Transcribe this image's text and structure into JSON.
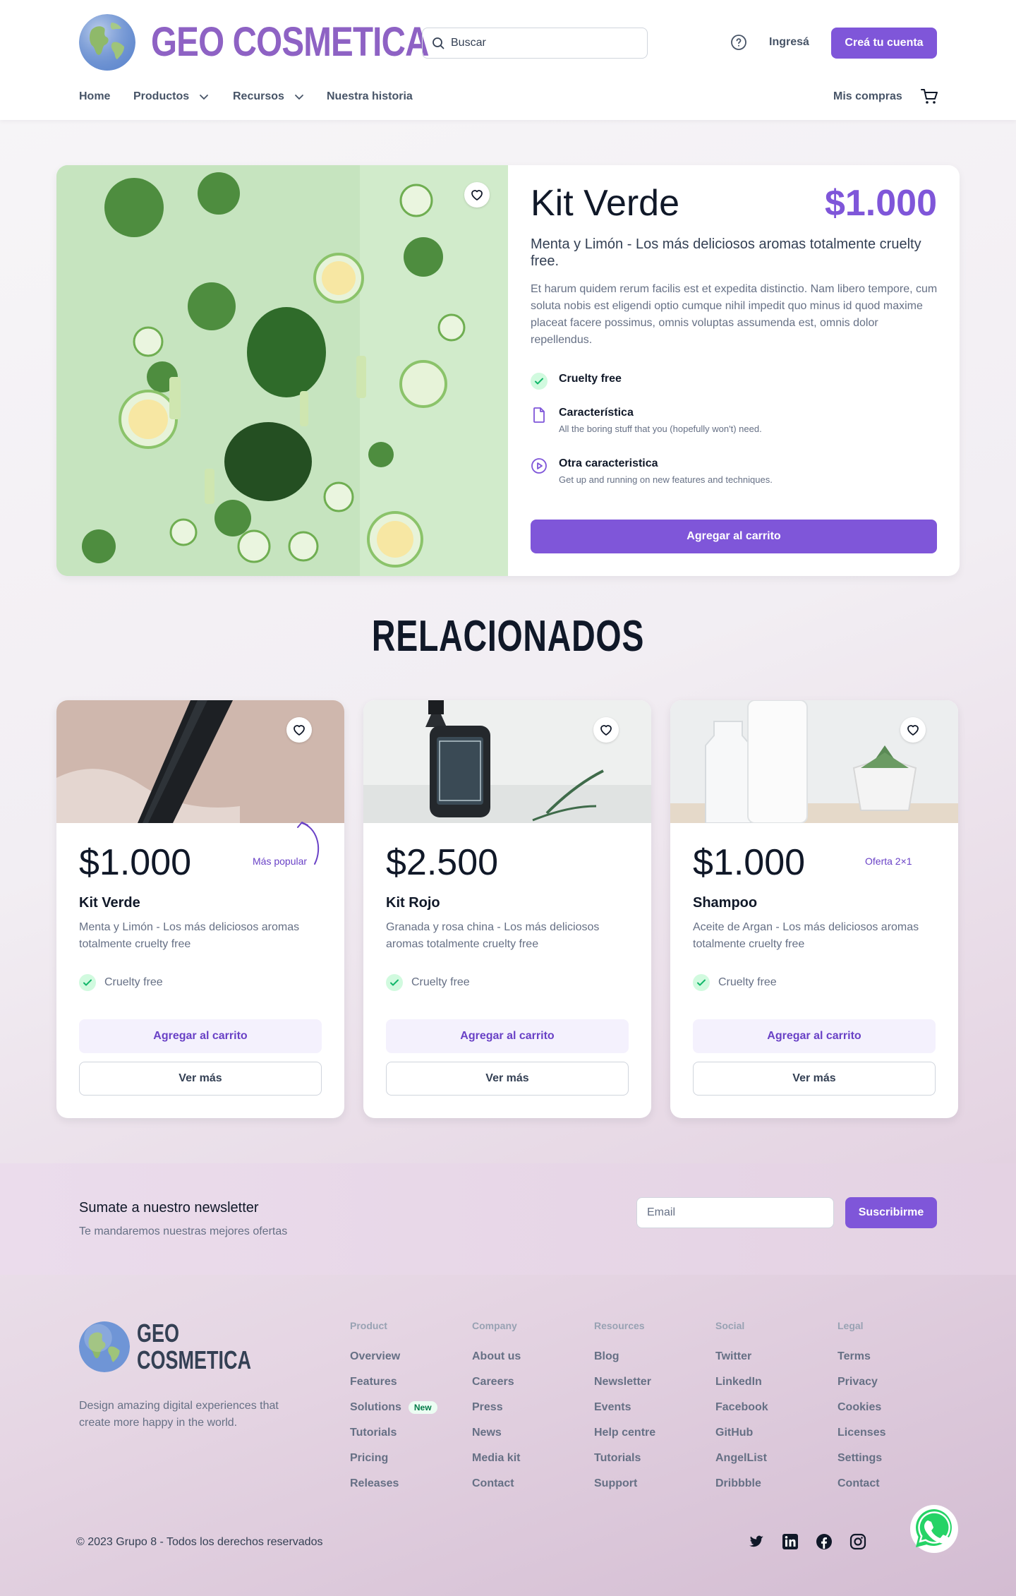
{
  "header": {
    "brand": "GEO COSMETICA",
    "search_placeholder": "Buscar",
    "login": "Ingresá",
    "signup": "Creá tu cuenta",
    "nav": [
      "Home",
      "Productos",
      "Recursos",
      "Nuestra historia"
    ],
    "my_purchases": "Mis compras"
  },
  "product": {
    "title": "Kit Verde",
    "price": "$1.000",
    "subtitle": "Menta y Limón - Los más deliciosos aromas totalmente cruelty free.",
    "description": "Et harum quidem rerum facilis est et expedita distinctio. Nam libero tempore, cum soluta nobis est eligendi optio cumque nihil impedit quo minus id quod maxime placeat facere possimus, omnis voluptas assumenda est, omnis dolor repellendus.",
    "features": [
      {
        "title": "Cruelty free",
        "desc": "",
        "icon": "check-circle-icon"
      },
      {
        "title": "Característica",
        "desc": "All the boring stuff that you (hopefully won't) need.",
        "icon": "file-icon"
      },
      {
        "title": "Otra caracteristica",
        "desc": "Get up and running on new features and techniques.",
        "icon": "play-circle-icon"
      }
    ],
    "add_to_cart": "Agregar al carrito"
  },
  "related": {
    "title": "RELACIONADOS",
    "cards": [
      {
        "price": "$1.000",
        "tag": "Más popular",
        "name": "Kit Verde",
        "desc": "Menta y Limón - Los más deliciosos aromas totalmente cruelty free",
        "feature": "Cruelty free",
        "add": "Agregar al carrito",
        "more": "Ver más"
      },
      {
        "price": "$2.500",
        "tag": "",
        "name": "Kit Rojo",
        "desc": "Granada y rosa china - Los más deliciosos aromas totalmente cruelty free",
        "feature": "Cruelty free",
        "add": "Agregar al carrito",
        "more": "Ver más"
      },
      {
        "price": "$1.000",
        "tag": "Oferta 2×1",
        "name": "Shampoo",
        "desc": "Aceite de Argan - Los más deliciosos aromas totalmente cruelty free",
        "feature": "Cruelty free",
        "add": "Agregar al carrito",
        "more": "Ver más"
      }
    ]
  },
  "newsletter": {
    "title": "Sumate a nuestro newsletter",
    "subtitle": "Te mandaremos nuestras mejores ofertas",
    "email_placeholder": "Email",
    "button": "Suscribirme"
  },
  "footer": {
    "brand_line1": "GEO",
    "brand_line2": "COSMETICA",
    "tagline": "Design amazing digital experiences that create more happy in the world.",
    "columns": [
      {
        "heading": "Product",
        "links": [
          "Overview",
          "Features",
          "Solutions",
          "Tutorials",
          "Pricing",
          "Releases"
        ]
      },
      {
        "heading": "Company",
        "links": [
          "About us",
          "Careers",
          "Press",
          "News",
          "Media kit",
          "Contact"
        ]
      },
      {
        "heading": "Resources",
        "links": [
          "Blog",
          "Newsletter",
          "Events",
          "Help centre",
          "Tutorials",
          "Support"
        ]
      },
      {
        "heading": "Social",
        "links": [
          "Twitter",
          "LinkedIn",
          "Facebook",
          "GitHub",
          "AngelList",
          "Dribbble"
        ]
      },
      {
        "heading": "Legal",
        "links": [
          "Terms",
          "Privacy",
          "Cookies",
          "Licenses",
          "Settings",
          "Contact"
        ]
      }
    ],
    "new_badge": "New",
    "copyright": "© 2023 Grupo 8 - Todos los derechos reservados"
  },
  "colors": {
    "accent": "#7f56d9",
    "brand": "#8e62c4",
    "whatsapp": "#25d366"
  }
}
